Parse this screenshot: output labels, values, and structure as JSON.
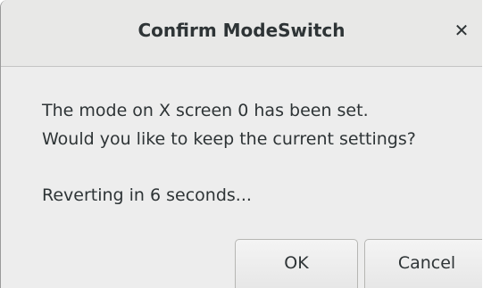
{
  "dialog": {
    "title": "Confirm ModeSwitch",
    "close_icon": "close-icon",
    "message_line1": "The mode on X screen 0 has been set.",
    "message_line2": "Would you like to keep the current settings?",
    "countdown": "Reverting in 6 seconds...",
    "buttons": {
      "ok_label": "OK",
      "cancel_label": "Cancel"
    }
  }
}
